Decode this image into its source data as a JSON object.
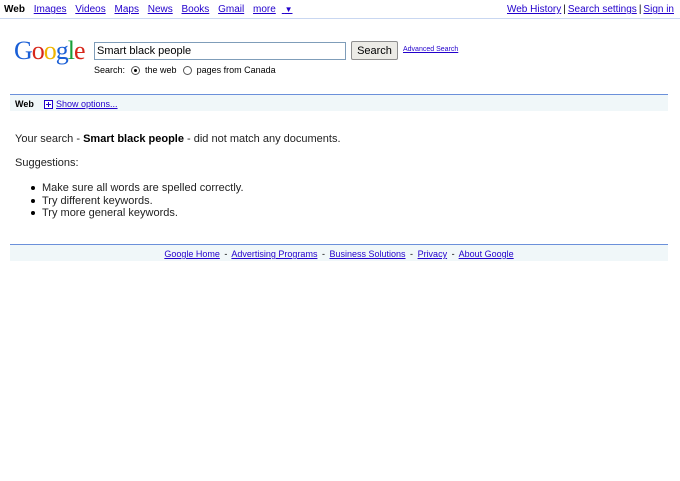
{
  "topbar": {
    "current": "Web",
    "links": [
      "Images",
      "Videos",
      "Maps",
      "News",
      "Books",
      "Gmail"
    ],
    "more": "more",
    "more_arrow": "▼",
    "right_links": [
      "Web History",
      "Search settings",
      "Sign in"
    ],
    "separator": "|"
  },
  "logo": {
    "letters": [
      "G",
      "o",
      "o",
      "g",
      "l",
      "e"
    ],
    "colors": [
      "#1a5fd6",
      "#d7261a",
      "#f0b400",
      "#1a5fd6",
      "#199e38",
      "#d7261a"
    ]
  },
  "search": {
    "value": "Smart black people",
    "button_label": "Search",
    "advanced_label": "Advanced Search",
    "scope_label": "Search:",
    "option_web": "the web",
    "option_canada": "pages from Canada"
  },
  "resultsbar": {
    "tab": "Web",
    "show_options": "Show options..."
  },
  "message": {
    "prefix": "Your search -",
    "query": "Smart black people",
    "suffix": "- did not match any documents."
  },
  "suggestions": {
    "title": "Suggestions:",
    "items": [
      "Make sure all words are spelled correctly.",
      "Try different keywords.",
      "Try more general keywords."
    ]
  },
  "footer": {
    "links": [
      "Google Home",
      "Advertising Programs",
      "Business Solutions",
      "Privacy",
      "About Google"
    ],
    "separator": "-"
  }
}
